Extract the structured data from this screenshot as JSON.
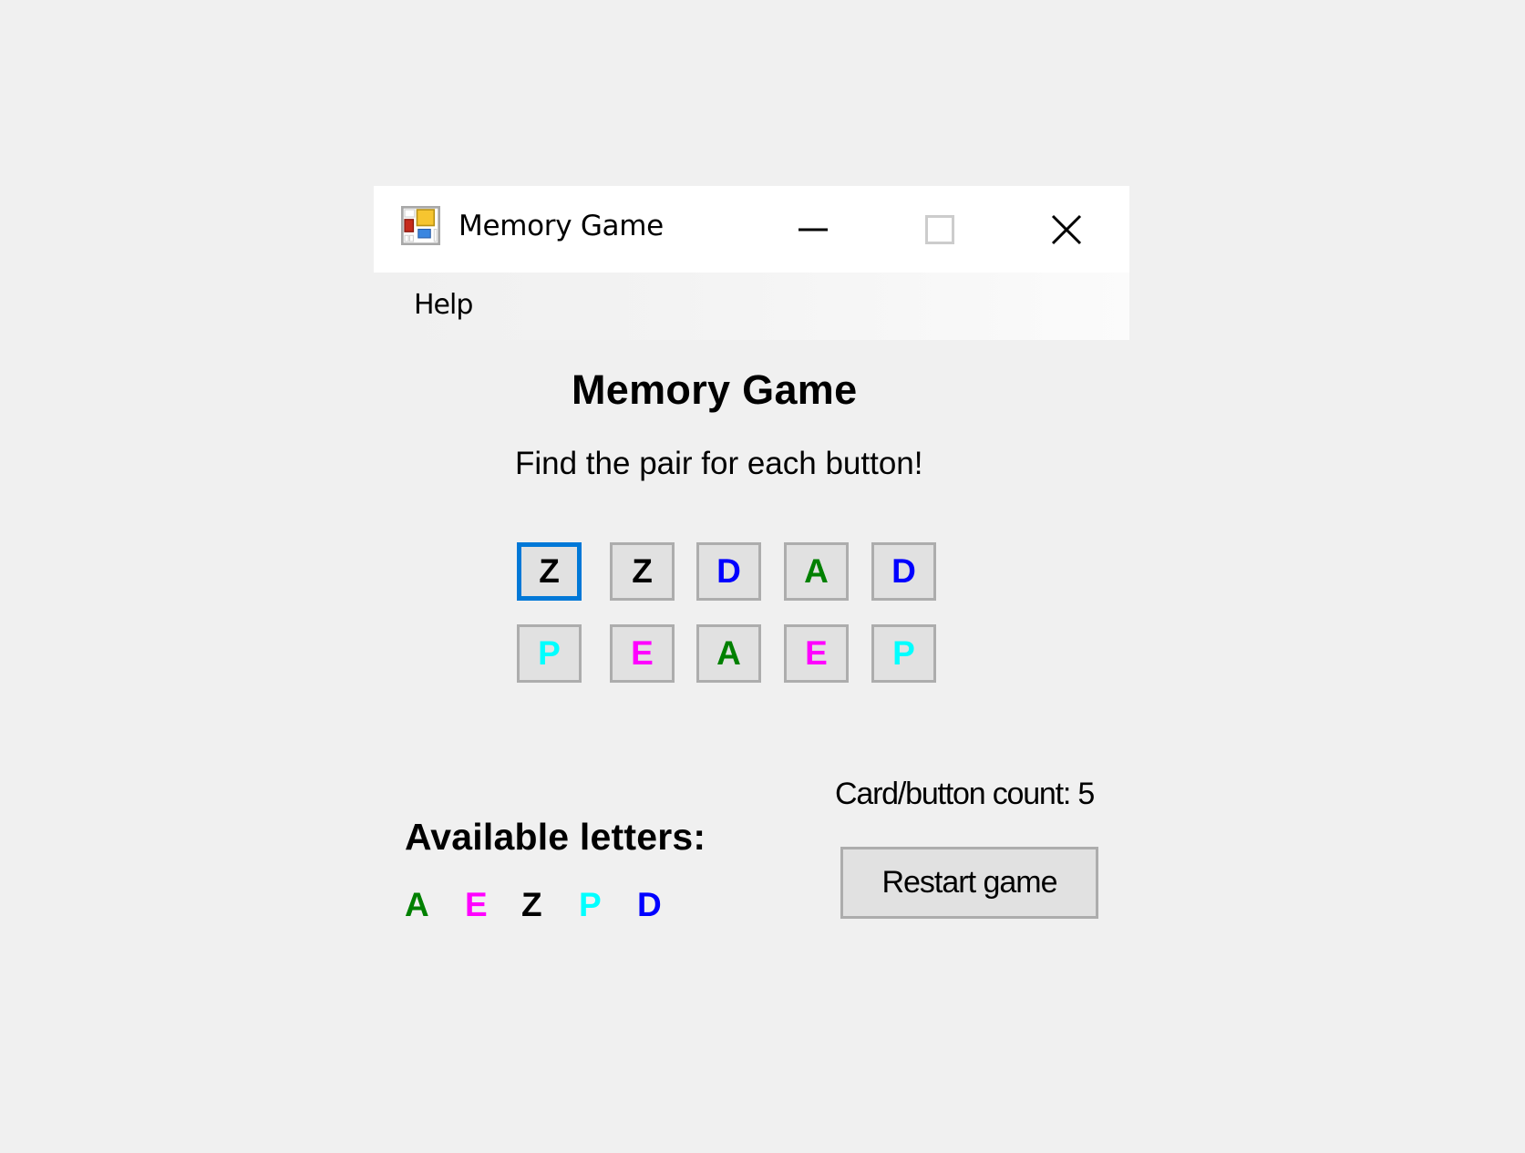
{
  "window": {
    "title": "Memory Game",
    "icon": "app-form-icon",
    "controls": {
      "minimize": "minimize-icon",
      "maximize": "maximize-icon",
      "maximize_enabled": false,
      "close": "close-icon"
    }
  },
  "menu": {
    "items": [
      {
        "label": "Help"
      }
    ]
  },
  "main": {
    "title": "Memory Game",
    "subtitle": "Find the pair for each button!"
  },
  "cards": [
    {
      "letter": "Z",
      "color": "#000000",
      "focused": true
    },
    {
      "letter": "Z",
      "color": "#000000",
      "focused": false
    },
    {
      "letter": "D",
      "color": "#0000ff",
      "focused": false
    },
    {
      "letter": "A",
      "color": "#008000",
      "focused": false
    },
    {
      "letter": "D",
      "color": "#0000ff",
      "focused": false
    },
    {
      "letter": "P",
      "color": "#00ffff",
      "focused": false
    },
    {
      "letter": "E",
      "color": "#ff00ff",
      "focused": false
    },
    {
      "letter": "A",
      "color": "#008000",
      "focused": false
    },
    {
      "letter": "E",
      "color": "#ff00ff",
      "focused": false
    },
    {
      "letter": "P",
      "color": "#00ffff",
      "focused": false
    }
  ],
  "count": {
    "label": "Card/button count: 5",
    "value": 5
  },
  "available": {
    "label": "Available letters:",
    "letters": [
      {
        "letter": "A",
        "color": "#008000"
      },
      {
        "letter": "E",
        "color": "#ff00ff"
      },
      {
        "letter": "Z",
        "color": "#000000"
      },
      {
        "letter": "P",
        "color": "#00ffff"
      },
      {
        "letter": "D",
        "color": "#0000ff"
      }
    ]
  },
  "buttons": {
    "restart": "Restart game"
  },
  "colors": {
    "focus_border": "#0078d7",
    "button_face": "#e1e1e1",
    "button_border": "#adadad",
    "window_bg": "#f0f0f0"
  }
}
